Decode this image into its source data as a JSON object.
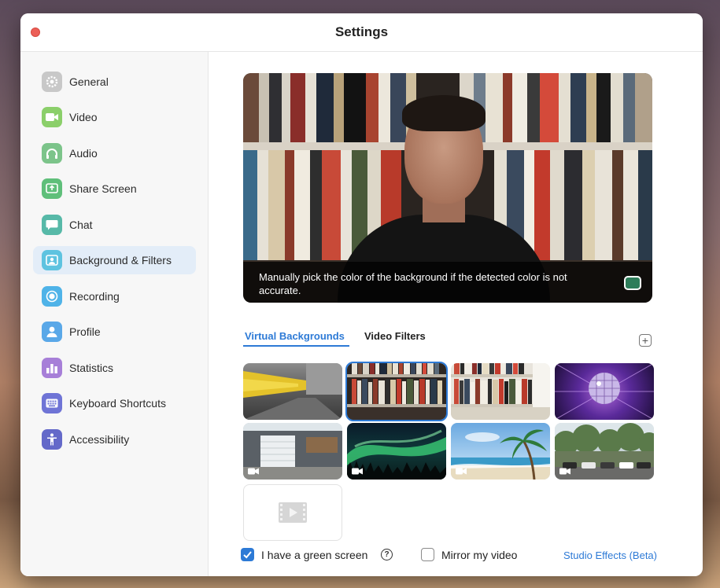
{
  "window": {
    "title": "Settings"
  },
  "sidebar": {
    "items": [
      {
        "label": "General",
        "icon": "gear-icon",
        "color": "#c8c8c8"
      },
      {
        "label": "Video",
        "icon": "video-camera-icon",
        "color": "#8bcf6a"
      },
      {
        "label": "Audio",
        "icon": "headphones-icon",
        "color": "#7cc48a"
      },
      {
        "label": "Share Screen",
        "icon": "share-screen-icon",
        "color": "#5fbf7a"
      },
      {
        "label": "Chat",
        "icon": "chat-bubble-icon",
        "color": "#57b9a8"
      },
      {
        "label": "Background & Filters",
        "icon": "background-person-icon",
        "color": "#5ec3e0"
      },
      {
        "label": "Recording",
        "icon": "record-icon",
        "color": "#4fb3e8"
      },
      {
        "label": "Profile",
        "icon": "profile-person-icon",
        "color": "#5aa8e8"
      },
      {
        "label": "Statistics",
        "icon": "bar-chart-icon",
        "color": "#a77fd8"
      },
      {
        "label": "Keyboard Shortcuts",
        "icon": "keyboard-icon",
        "color": "#6f74d6"
      },
      {
        "label": "Accessibility",
        "icon": "accessibility-icon",
        "color": "#6469c9"
      }
    ],
    "active_index": 5
  },
  "preview": {
    "caption": "Manually pick the color of the background if the detected color is not accurate.",
    "color_swatch": "#2e7d5a"
  },
  "tabs": [
    {
      "label": "Virtual Backgrounds",
      "active": true
    },
    {
      "label": "Video Filters",
      "active": false
    }
  ],
  "backgrounds": [
    {
      "name": "motion-street",
      "video": false,
      "selected": false
    },
    {
      "name": "bookshelf-dark",
      "video": false,
      "selected": true
    },
    {
      "name": "bookshelf-light",
      "video": false,
      "selected": false
    },
    {
      "name": "disco-ball",
      "video": false,
      "selected": false
    },
    {
      "name": "garage-building",
      "video": true,
      "selected": false
    },
    {
      "name": "northern-lights",
      "video": true,
      "selected": false
    },
    {
      "name": "beach-palm",
      "video": true,
      "selected": false
    },
    {
      "name": "park-cars",
      "video": true,
      "selected": false
    }
  ],
  "options": {
    "green_screen_label": "I have a green screen",
    "green_screen_checked": true,
    "mirror_label": "Mirror my video",
    "mirror_checked": false,
    "studio_effects_label": "Studio Effects (Beta)"
  }
}
